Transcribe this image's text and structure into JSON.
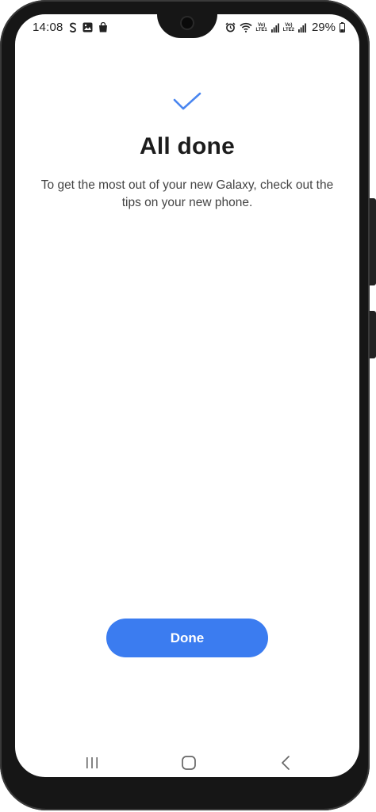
{
  "status_bar": {
    "time": "14:08",
    "battery": "29%",
    "sim1": {
      "top": "Vo)",
      "bottom": "LTE1"
    },
    "sim2": {
      "top": "Vo)",
      "bottom": "LTE2"
    },
    "left_icons": [
      "samsung-s-icon",
      "gallery-icon",
      "shopping-bag-icon"
    ],
    "right_icons": [
      "alarm-icon",
      "wifi-icon",
      "signal-icon",
      "battery-icon"
    ]
  },
  "main": {
    "icon": "checkmark-icon",
    "title": "All done",
    "subtitle": "To get the most out of your new Galaxy, check out the tips on your new phone.",
    "done_label": "Done"
  },
  "colors": {
    "accent": "#3b7cf0",
    "check": "#4a86f0",
    "title": "#1c1c1c",
    "body_text": "#444444",
    "bezel": "#161616"
  },
  "nav_bar": {
    "icons": [
      "recent-apps-icon",
      "home-icon",
      "back-icon"
    ]
  }
}
